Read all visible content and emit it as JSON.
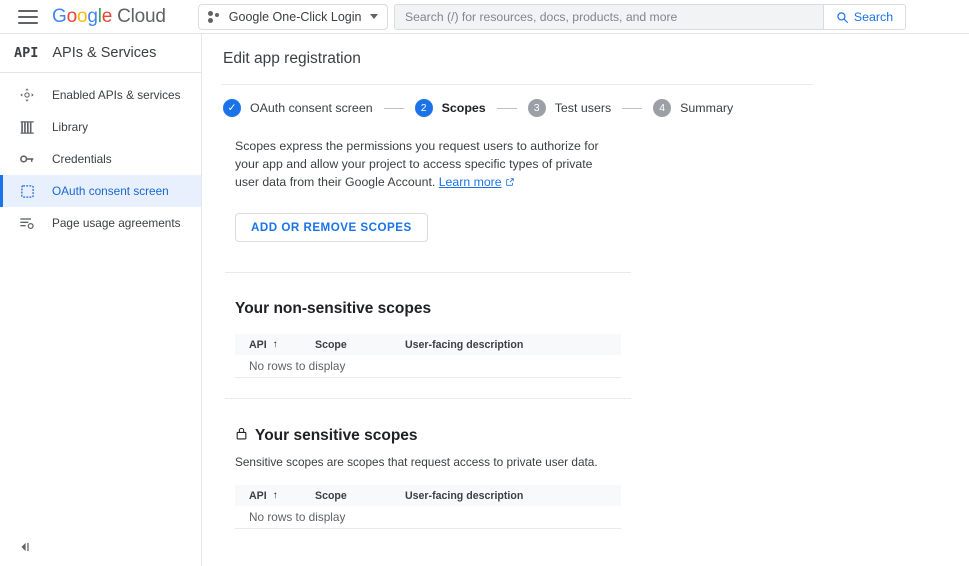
{
  "topbar": {
    "menu_icon": "hamburger-icon",
    "brand": {
      "google": "Google",
      "cloud": "Cloud"
    },
    "project": {
      "name": "Google One-Click Login",
      "icon": "project-dots-icon",
      "caret": "chevron-down-icon"
    },
    "search": {
      "placeholder": "Search (/) for resources, docs, products, and more",
      "value": "",
      "button_label": "Search",
      "icon": "search-icon"
    }
  },
  "sidebar": {
    "logo": "API",
    "title": "APIs & Services",
    "collapse_icon": "collapse-panel-icon",
    "items": [
      {
        "label": "Enabled APIs & services",
        "icon": "dashboard-move-icon",
        "active": false
      },
      {
        "label": "Library",
        "icon": "library-icon",
        "active": false
      },
      {
        "label": "Credentials",
        "icon": "key-icon",
        "active": false
      },
      {
        "label": "OAuth consent screen",
        "icon": "consent-screen-icon",
        "active": true
      },
      {
        "label": "Page usage agreements",
        "icon": "page-agreement-icon",
        "active": false
      }
    ]
  },
  "main": {
    "page_title": "Edit app registration",
    "stepper": [
      {
        "number": "1",
        "marker": "✓",
        "label": "OAuth consent screen",
        "state": "done"
      },
      {
        "number": "2",
        "marker": "2",
        "label": "Scopes",
        "state": "current"
      },
      {
        "number": "3",
        "marker": "3",
        "label": "Test users",
        "state": "todo"
      },
      {
        "number": "4",
        "marker": "4",
        "label": "Summary",
        "state": "todo"
      }
    ],
    "description": "Scopes express the permissions you request users to authorize for your app and allow your project to access specific types of private user data from their Google Account.",
    "learn_more": "Learn more",
    "add_remove_button": "ADD OR REMOVE SCOPES",
    "table_columns": {
      "api": "API",
      "scope": "Scope",
      "description": "User-facing description"
    },
    "empty_text": "No rows to display",
    "non_sensitive": {
      "heading": "Your non-sensitive scopes",
      "rows": []
    },
    "sensitive": {
      "heading": "Your sensitive scopes",
      "lock_icon": "lock-icon",
      "subtitle": "Sensitive scopes are scopes that request access to private user data.",
      "rows": []
    }
  },
  "colors": {
    "accent": "#1a73e8",
    "active_bg": "#e8f0fe",
    "grey_badge": "#9aa0a6",
    "divider": "#e8eaed"
  }
}
